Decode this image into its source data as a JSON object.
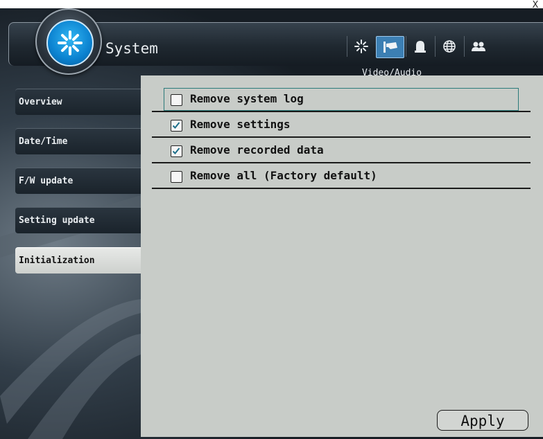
{
  "window": {
    "close_label": "X",
    "title": "System"
  },
  "header_tabs": [
    {
      "name": "system-tab",
      "icon": "sparkle-icon",
      "active": false
    },
    {
      "name": "video-audio-tab",
      "icon": "camera-icon",
      "active": true
    },
    {
      "name": "event-tab",
      "icon": "alarm-icon",
      "active": false
    },
    {
      "name": "network-tab",
      "icon": "globe-icon",
      "active": false
    },
    {
      "name": "users-tab",
      "icon": "users-icon",
      "active": false
    }
  ],
  "subtitle": "Video/Audio",
  "sidebar": {
    "items": [
      {
        "label": "Overview",
        "active": false
      },
      {
        "label": "Date/Time",
        "active": false
      },
      {
        "label": "F/W update",
        "active": false
      },
      {
        "label": "Setting update",
        "active": false
      },
      {
        "label": "Initialization",
        "active": true
      }
    ]
  },
  "options": [
    {
      "label": "Remove system log",
      "checked": false,
      "focused": true
    },
    {
      "label": "Remove settings",
      "checked": true,
      "focused": false
    },
    {
      "label": "Remove recorded data",
      "checked": true,
      "focused": false
    },
    {
      "label": "Remove all (Factory default)",
      "checked": false,
      "focused": false
    }
  ],
  "apply_label": "Apply",
  "colors": {
    "accent_blue": "#0b82d0",
    "content_bg": "#c8ccc8",
    "dark_bg": "#1e2730",
    "check_color": "#1d6f8a"
  }
}
